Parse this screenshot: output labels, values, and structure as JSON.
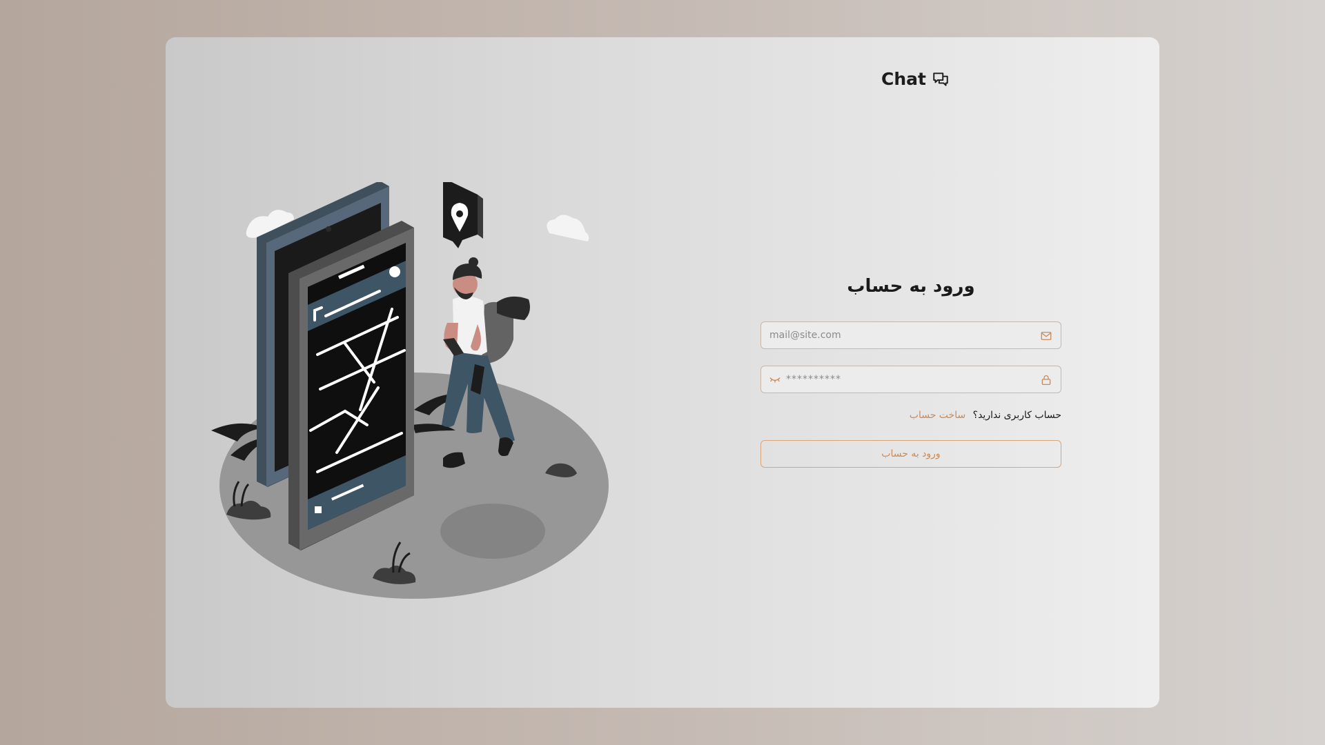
{
  "brand": {
    "name": "Chat",
    "icon": "chat-bubbles-icon"
  },
  "login": {
    "title": "ورود به حساب",
    "email": {
      "value": "",
      "placeholder": "mail@site.com",
      "icon": "mail-icon"
    },
    "password": {
      "value": "",
      "placeholder": "**********",
      "icon": "lock-icon",
      "toggle_icon": "eye-closed-icon"
    },
    "no_account_text": "حساب کاربری ندارید؟",
    "signup_link": "ساخت حساب",
    "submit_label": "ورود به حساب"
  },
  "colors": {
    "accent": "#c98a58",
    "field_border": "#c6b7ac",
    "page_background": "#b4a69c",
    "card_background": "#e4e4e4"
  }
}
